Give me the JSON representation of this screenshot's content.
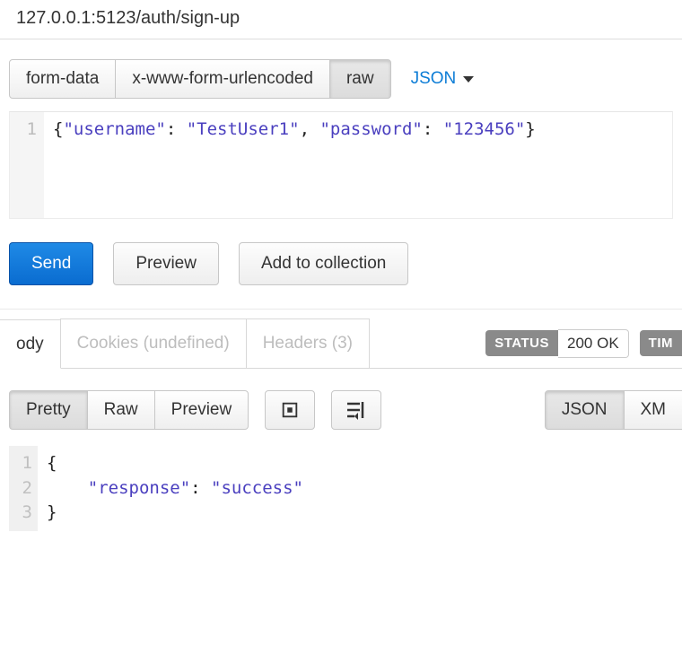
{
  "url": "127.0.0.1:5123/auth/sign-up",
  "body_type_tabs": {
    "form_data": "form-data",
    "urlencoded": "x-www-form-urlencoded",
    "raw": "raw"
  },
  "body_type_active": "raw",
  "content_type_dropdown": "JSON",
  "request_body": {
    "line_numbers": [
      "1"
    ],
    "tokens": [
      {
        "t": "pln",
        "v": "{"
      },
      {
        "t": "key",
        "v": "\"username\""
      },
      {
        "t": "pln",
        "v": ": "
      },
      {
        "t": "str",
        "v": "\"TestUser1\""
      },
      {
        "t": "pln",
        "v": ", "
      },
      {
        "t": "key",
        "v": "\"password\""
      },
      {
        "t": "pln",
        "v": ": "
      },
      {
        "t": "str",
        "v": "\"123456\""
      },
      {
        "t": "pln",
        "v": "}"
      }
    ]
  },
  "action_buttons": {
    "send": "Send",
    "preview": "Preview",
    "add_collection": "Add to collection"
  },
  "response_tabs": {
    "body": "ody",
    "cookies": "Cookies (undefined)",
    "headers": "Headers (3)"
  },
  "status": {
    "label": "STATUS",
    "value": "200 OK",
    "time_label": "TIM"
  },
  "format_tabs": {
    "pretty": "Pretty",
    "raw": "Raw",
    "preview": "Preview"
  },
  "lang_tabs": {
    "json": "JSON",
    "xml": "XM"
  },
  "response_body": {
    "line_numbers": [
      "1",
      "2",
      "3"
    ],
    "lines": [
      [
        {
          "t": "pln",
          "v": "{"
        }
      ],
      [
        {
          "t": "pln",
          "v": "    "
        },
        {
          "t": "key",
          "v": "\"response\""
        },
        {
          "t": "pln",
          "v": ": "
        },
        {
          "t": "str",
          "v": "\"success\""
        }
      ],
      [
        {
          "t": "pln",
          "v": "}"
        }
      ]
    ]
  }
}
